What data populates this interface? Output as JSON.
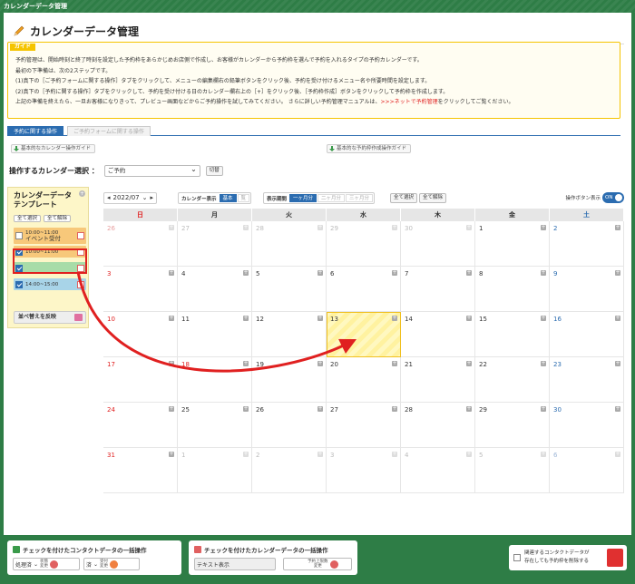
{
  "window_title": "カレンダーデータ管理",
  "page_title": "カレンダーデータ管理",
  "guide": {
    "tag": "ガイド",
    "lines": [
      "予約管理は、開始時刻と終了時刻を設定した予約枠をあらかじめお店側で作成し、お客様がカレンダーから予約枠を選んで予約を入れるタイプの予約カレンダーです。",
      "最初の下準備は、次の2ステップです。",
      "(1)真下の［ご予約フォームに関する操作］タブをクリックして、メニューの編集欄右の鉛筆ボタンをクリック後、予約を受け付けるメニュー名や所要時間を設定します。",
      "(2)真下の［予約に関する操作］タブをクリックして、予約を受け付ける日のカレンダー欄右上の［+］をクリック後、［予約枠作成］ボタンをクリックして予約枠を作成します。"
    ],
    "last_line_before": "上記の準備を終えたら、一旦お客様になりきって、プレビュー画面などからご予約操作を試してみてください。 さらに詳しい予約管理マニュアルは、",
    "last_line_link": ">>>ネットで予約管理",
    "last_line_after": "をクリックしてご覧ください。"
  },
  "tabs": {
    "active": "予約に関する操作",
    "inactive": "ご予約フォームに関する操作"
  },
  "guide_buttons": {
    "left": "基本的なカレンダー操作ガイド",
    "right": "基本的な予約枠作成操作ガイド"
  },
  "calendar_select": {
    "label": "操作するカレンダー選択 ：",
    "value": "ご予約",
    "switch_label": "切替"
  },
  "template_panel": {
    "title_line1": "カレンダーデータ",
    "title_line2": "テンプレート",
    "select_all": "全て選択",
    "deselect_all": "全て解除",
    "items": [
      {
        "line1": "10:00~11:00",
        "line2": "イベント受付",
        "checked": false,
        "color": "#f7c87a"
      },
      {
        "line1": "10:00~11:00",
        "line2": "",
        "checked": true,
        "color": "#f7c87a"
      },
      {
        "line1": "",
        "line2": "",
        "checked": true,
        "color": "#a8dca8"
      },
      {
        "line1": "14:00~15:00",
        "line2": "",
        "checked": true,
        "color": "#a8d4e8"
      }
    ],
    "reorder_label": "並べ替えを反映"
  },
  "toolbar": {
    "month": "2022/07",
    "display_label": "カレンダー表示",
    "display_basic": "基本",
    "display_detail": "覧",
    "period_label": "表示期間",
    "period_1m": "一ヶ月分",
    "period_2m": "二ヶ月分",
    "period_3m": "三ヶ月分",
    "select_all": "全て選択",
    "deselect_all": "全て解除",
    "op_button_label": "操作ボタン表示",
    "toggle_state": "ON"
  },
  "weekdays": [
    "日",
    "月",
    "火",
    "水",
    "木",
    "金",
    "土"
  ],
  "weeks": [
    [
      {
        "d": "26",
        "o": true
      },
      {
        "d": "27",
        "o": true
      },
      {
        "d": "28",
        "o": true
      },
      {
        "d": "29",
        "o": true
      },
      {
        "d": "30",
        "o": true
      },
      {
        "d": "1"
      },
      {
        "d": "2"
      }
    ],
    [
      {
        "d": "3"
      },
      {
        "d": "4"
      },
      {
        "d": "5"
      },
      {
        "d": "6"
      },
      {
        "d": "7"
      },
      {
        "d": "8"
      },
      {
        "d": "9"
      }
    ],
    [
      {
        "d": "10"
      },
      {
        "d": "11"
      },
      {
        "d": "12"
      },
      {
        "d": "13",
        "today": true
      },
      {
        "d": "14"
      },
      {
        "d": "15"
      },
      {
        "d": "16"
      }
    ],
    [
      {
        "d": "17"
      },
      {
        "d": "18",
        "holiday": true
      },
      {
        "d": "19"
      },
      {
        "d": "20"
      },
      {
        "d": "21"
      },
      {
        "d": "22"
      },
      {
        "d": "23"
      }
    ],
    [
      {
        "d": "24"
      },
      {
        "d": "25"
      },
      {
        "d": "26"
      },
      {
        "d": "27"
      },
      {
        "d": "28"
      },
      {
        "d": "29"
      },
      {
        "d": "30"
      }
    ],
    [
      {
        "d": "31"
      },
      {
        "d": "1",
        "o": true
      },
      {
        "d": "2",
        "o": true
      },
      {
        "d": "3",
        "o": true
      },
      {
        "d": "4",
        "o": true
      },
      {
        "d": "5",
        "o": true
      },
      {
        "d": "6",
        "o": true
      }
    ]
  ],
  "bottom": {
    "contact_title": "チェックを付けたコンタクトデータの一括操作",
    "contact_select1": "処理済",
    "contact_small1a": "状態",
    "contact_small1b": "変更",
    "contact_select2": "済",
    "contact_small2a": "受付",
    "contact_small2b": "変更",
    "calendar_title": "チェックを付けたカレンダーデータの一括操作",
    "text_display": "テキスト表示",
    "limit_a": "予約上限数",
    "limit_b": "変更",
    "delete_note_a": "関連するコンタクトデータが",
    "delete_note_b": "存在しても予約枠を削除する"
  },
  "colors": {
    "accent": "#2b6cb0",
    "frame": "#2e7d46",
    "guide_border": "#f5c400",
    "annotation_red": "#e02020"
  }
}
